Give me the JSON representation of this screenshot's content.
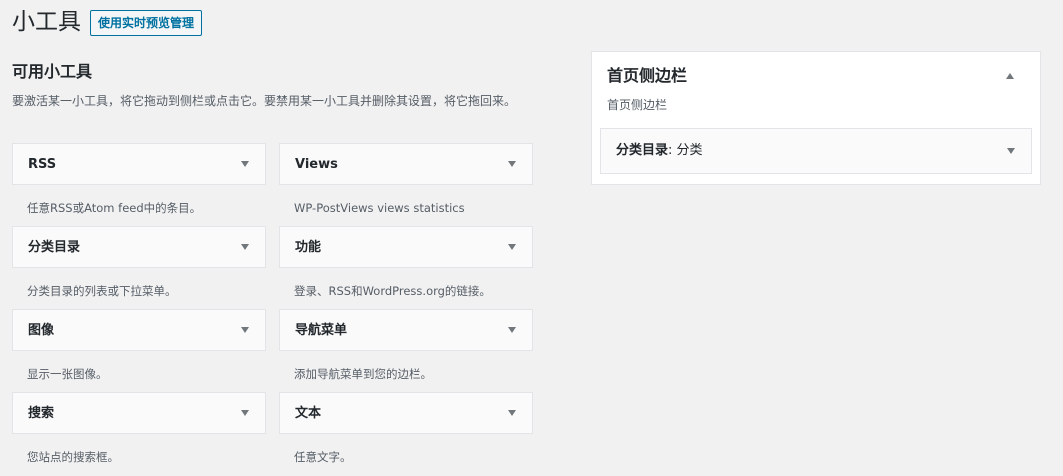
{
  "page": {
    "title": "小工具",
    "manage_button": "使用实时预览管理"
  },
  "available": {
    "heading": "可用小工具",
    "description": "要激活某一小工具，将它拖动到侧栏或点击它。要禁用某一小工具并删除其设置，将它拖回来。",
    "widgets": [
      {
        "name": "RSS",
        "desc": "任意RSS或Atom feed中的条目。"
      },
      {
        "name": "Views",
        "desc": "WP-PostViews views statistics"
      },
      {
        "name": "分类目录",
        "desc": "分类目录的列表或下拉菜单。"
      },
      {
        "name": "功能",
        "desc": "登录、RSS和WordPress.org的链接。"
      },
      {
        "name": "图像",
        "desc": "显示一张图像。"
      },
      {
        "name": "导航菜单",
        "desc": "添加导航菜单到您的边栏。"
      },
      {
        "name": "搜索",
        "desc": "您站点的搜索框。"
      },
      {
        "name": "文本",
        "desc": "任意文字。"
      }
    ]
  },
  "sidebar": {
    "title": "首页侧边栏",
    "description": "首页侧边栏",
    "widget": {
      "name": "分类目录",
      "title_suffix": ": 分类"
    }
  },
  "colors": {
    "background": "#f1f1f1",
    "accent": "#0071a1",
    "text": "#23282d"
  }
}
